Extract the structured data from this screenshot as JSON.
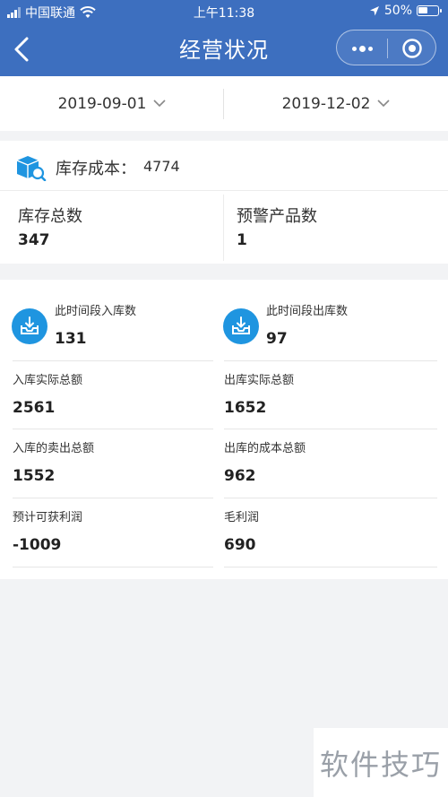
{
  "status_bar": {
    "carrier": "中国联通",
    "time": "上午11:38",
    "battery_text": "50%"
  },
  "nav": {
    "title": "经营状况"
  },
  "date_range": {
    "start": "2019-09-01",
    "end": "2019-12-02"
  },
  "inventory": {
    "cost_label": "库存成本：",
    "cost_value": "4774",
    "total_label": "库存总数",
    "total_value": "347",
    "warning_label": "预警产品数",
    "warning_value": "1"
  },
  "period": {
    "inbound_label": "此时间段入库数",
    "inbound_value": "131",
    "outbound_label": "此时间段出库数",
    "outbound_value": "97"
  },
  "metrics": [
    {
      "label": "入库实际总额",
      "value": "2561"
    },
    {
      "label": "出库实际总额",
      "value": "1652"
    },
    {
      "label": "入库的卖出总额",
      "value": "1552"
    },
    {
      "label": "出库的成本总额",
      "value": "962"
    },
    {
      "label": "预计可获利润",
      "value": "-1009"
    },
    {
      "label": "毛利润",
      "value": "690"
    }
  ],
  "watermark": "软件技巧",
  "colors": {
    "header": "#3d6fbf",
    "icon_blue": "#1f95e0",
    "background": "#f2f3f5"
  }
}
